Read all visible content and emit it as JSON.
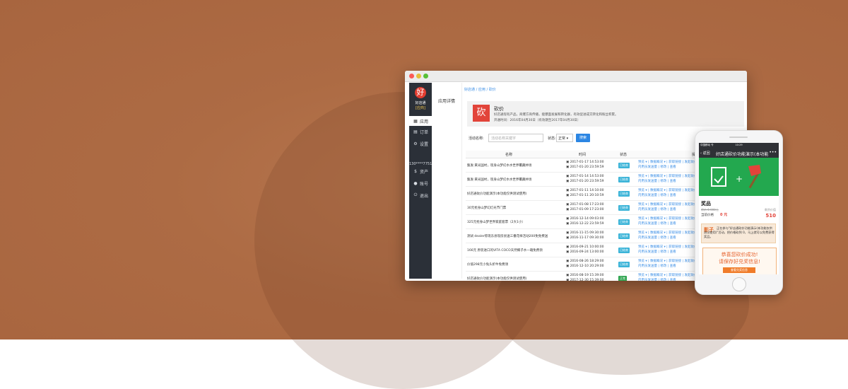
{
  "admin": {
    "logo_char": "好",
    "logo_name": "好店通",
    "logo_tag": "[应商]",
    "nav": [
      {
        "icon": "grid-icon",
        "glyph": "▦",
        "label": "应用"
      },
      {
        "icon": "order-icon",
        "glyph": "▤",
        "label": "订单"
      },
      {
        "icon": "settings-icon",
        "glyph": "⚙",
        "label": "设置"
      },
      {
        "icon": "asset-icon",
        "glyph": "$",
        "label": "资产"
      },
      {
        "icon": "account-icon",
        "glyph": "●",
        "label": "账号"
      },
      {
        "icon": "logout-icon",
        "glyph": "⏻",
        "label": "退出"
      }
    ],
    "phone_masked": "130****7751",
    "subnav_item": "应用详情",
    "breadcrumb": "好店通 / 应用 / 砍价",
    "banner": {
      "icon_char": "砍",
      "title": "砍价",
      "desc": "好店通现有产品，商爆方商传播，能爆面发展和转化群，有效促进成交转化和粉丝积累。",
      "period": "开通时间：2016年04月30日（有效期至2017年04月30日）"
    },
    "search": {
      "label": "活动名称:",
      "placeholder": "活动名称关键字",
      "status_label": "状态:",
      "status_value": "正常",
      "button": "搜索"
    },
    "table": {
      "headers": [
        "名称",
        "时间",
        "状态",
        "操作"
      ],
      "rows": [
        {
          "name": "甄发·黄光国村，现身山梦幻水水世界覆藏并场",
          "start": "2017-01-17 14:53:00",
          "end": "2017-01-20 23:59:59",
          "status": "已结束",
          "status_color": "#3cb4d8"
        },
        {
          "name": "甄发·黄光国村，现身山梦幻水水世界覆藏并场",
          "start": "2017-01-14 14:53:00",
          "end": "2017-01-20 23:59:59",
          "status": "已结束",
          "status_color": "#3cb4d8"
        },
        {
          "name": "好店通砍价功能演示(本功能仅供测试使用)",
          "start": "2017-01-11 14:10:00",
          "end": "2017-01-11 20:10:59",
          "status": "已结束",
          "status_color": "#3cb4d8"
        },
        {
          "name": "30元抢身山梦幻灯光节门票",
          "start": "2017-01-08 17:23:00",
          "end": "2017-01-09 17:23:00",
          "status": "已结束",
          "status_color": "#3cb4d8"
        },
        {
          "name": "325元抢身山梦世界家庭套票（2大1小）",
          "start": "2016-12-14 09:03:00",
          "end": "2016-12-22 23:59:59",
          "status": "已结束",
          "status_color": "#3cb4d8"
        },
        {
          "name": "测试·dealer惊现东县现房县送三番花样活动200免免费送",
          "start": "2016-11-15 09:30:00",
          "end": "2016-11-17 09:30:00",
          "status": "已结束",
          "status_color": "#3cb4d8"
        },
        {
          "name": "166元 原装进口的VITA COCO天然椰子水一箱免费领",
          "start": "2016-09-21 10:00:00",
          "end": "2016-09-24 13:00:00",
          "status": "已结束",
          "status_color": "#3cb4d8"
        },
        {
          "name": "价值298元小兔头折牛免费领",
          "start": "2016-08-26 18:29:00",
          "end": "2016-12-10 20:29:00",
          "status": "已结束",
          "status_color": "#3cb4d8"
        },
        {
          "name": "好店通砍价功能演示(本功能仅供测试使用)",
          "start": "2016-08-19 15:39:00",
          "end": "2017-12-30 15:39:00",
          "status": "正常",
          "status_color": "#2ea44f"
        }
      ],
      "ops_line1": "预览 ▾ | 数据概况 ▾ | 获取链接 | 发起砍价",
      "ops_line2": "内用员发送量 | 修改 | 查看"
    }
  },
  "phone": {
    "carrier": "中国移动 令",
    "time": "10:29",
    "back_label": "返回",
    "title": "好店通砍价功能演示(本功能",
    "more": "•••",
    "prize_title": "奖品",
    "orig_price": "原价 6 000元",
    "cur_label": "当前价格",
    "cur_price": "0 元",
    "sold_label": "剩余价值",
    "sold_value": "510",
    "msg_name": "影子",
    "msg_text": "正在参与\"好店通砍价功能演示(本功能仅供测试使用)\"活动，把价格砍到 0，马上就可以免费获得奖品。",
    "success_line1": "恭喜您砍价成功!",
    "success_line2": "请保存好兑奖信息!",
    "success_btn": "查看兑奖信息"
  }
}
